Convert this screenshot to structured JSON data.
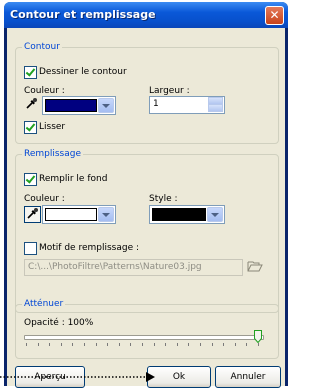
{
  "window": {
    "title": "Contour et remplissage",
    "close_glyph": "✕"
  },
  "contour": {
    "legend": "Contour",
    "draw_label": "Dessiner le contour",
    "draw_checked": true,
    "color_label": "Couleur :",
    "color_value": "#000080",
    "width_label": "Largeur :",
    "width_value": "1",
    "smooth_label": "Lisser",
    "smooth_checked": true
  },
  "fill": {
    "legend": "Remplissage",
    "fill_label": "Remplir le fond",
    "fill_checked": true,
    "color_label": "Couleur :",
    "color_value": "#ffffff",
    "style_label": "Style :",
    "style_value": "#000000",
    "pattern_label": "Motif de remplissage :",
    "pattern_checked": false,
    "pattern_path": "C:\\...\\PhotoFiltre\\Patterns\\Nature03.jpg"
  },
  "attenuate": {
    "legend": "Atténuer",
    "opacity_label": "Opacité : 100%",
    "opacity_fraction": 1.0
  },
  "buttons": {
    "preview": "Aperçu",
    "ok": "Ok",
    "cancel": "Annuler"
  },
  "icons": {
    "eyedropper": "eyedropper-icon",
    "folder": "folder-open-icon"
  },
  "colors": {
    "title_bar": "#0a58d8",
    "legend_text": "#0046d5",
    "dialog_bg": "#ece9d8"
  }
}
